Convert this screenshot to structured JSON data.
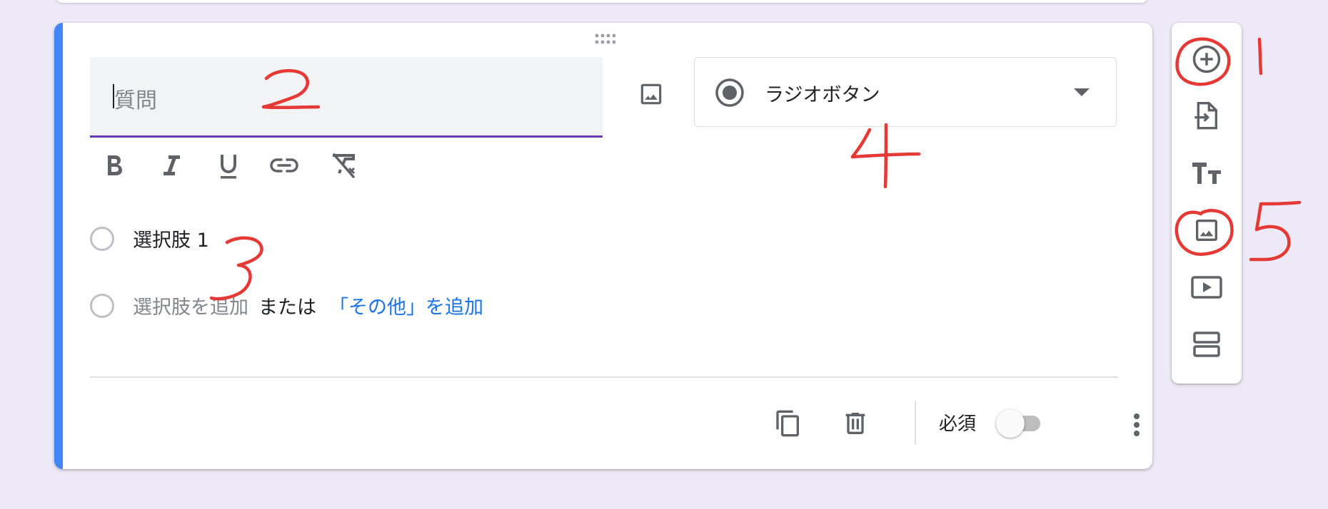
{
  "question": {
    "placeholder": "質問",
    "image_icon": "image-icon",
    "type_selector": {
      "label": "ラジオボタン",
      "icon": "radio-checked-icon",
      "arrow_icon": "dropdown-arrow-icon"
    }
  },
  "formatting_toolbar": [
    "bold-icon",
    "italic-icon",
    "underline-icon",
    "link-icon",
    "clear-format-icon"
  ],
  "options": {
    "option1": "選択肢 1",
    "add_option": "選択肢を追加",
    "or": "または",
    "add_other": "「その他」を追加"
  },
  "footer": {
    "duplicate_icon": "copy-icon",
    "delete_icon": "trash-icon",
    "required_label": "必須",
    "required_on": false,
    "more_icon": "more-vert-icon"
  },
  "sidebar_tools": [
    "add-question-icon",
    "import-questions-icon",
    "add-title-icon",
    "add-image-icon",
    "add-video-icon",
    "add-section-icon"
  ],
  "annotations": {
    "color": "#e53935",
    "numbers": [
      "1",
      "2",
      "3",
      "4",
      "5"
    ]
  },
  "colors": {
    "accent": "#4285f4",
    "underline": "#673ab7",
    "link": "#1a73e8",
    "background": "#ede9f6"
  }
}
